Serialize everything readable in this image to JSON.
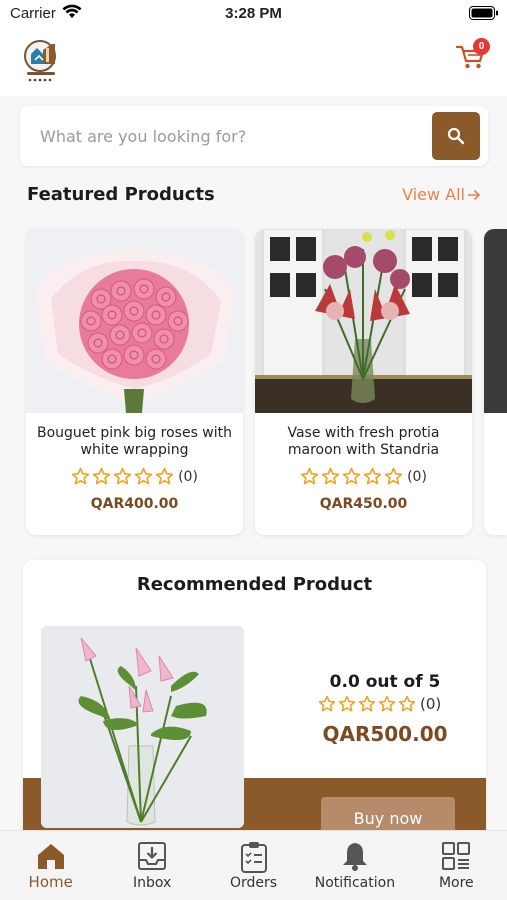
{
  "status_bar": {
    "carrier": "Carrier",
    "time": "3:28 PM"
  },
  "header": {
    "logo_icon": "store-logo-icon",
    "cart_icon": "shopping-cart-icon",
    "cart_count": "0"
  },
  "search": {
    "placeholder": "What are you looking for?",
    "value": "",
    "button_icon": "search-icon"
  },
  "featured": {
    "title": "Featured Products",
    "view_all": "View All",
    "products": [
      {
        "name": "Bouguet pink big roses with white wrapping",
        "rating_count": "(0)",
        "rating": 0,
        "price": "QAR400.00"
      },
      {
        "name": "Vase with fresh protia maroon with Standria",
        "rating_count": "(0)",
        "rating": 0,
        "price": "QAR450.00"
      }
    ]
  },
  "recommended": {
    "title": "Recommended Product",
    "score": "0.0 out of 5",
    "rating_count": "(0)",
    "rating": 0,
    "price": "QAR500.00",
    "buy_label": "Buy now"
  },
  "tabs": [
    {
      "label": "Home",
      "icon": "home-icon",
      "active": true
    },
    {
      "label": "Inbox",
      "icon": "inbox-icon",
      "active": false
    },
    {
      "label": "Orders",
      "icon": "clipboard-icon",
      "active": false
    },
    {
      "label": "Notification",
      "icon": "bell-icon",
      "active": false
    },
    {
      "label": "More",
      "icon": "grid-icon",
      "active": false
    }
  ],
  "colors": {
    "brand_brown": "#8b5a2b",
    "accent_orange": "#e8834a",
    "star": "#f0a020",
    "badge_red": "#e53935"
  }
}
